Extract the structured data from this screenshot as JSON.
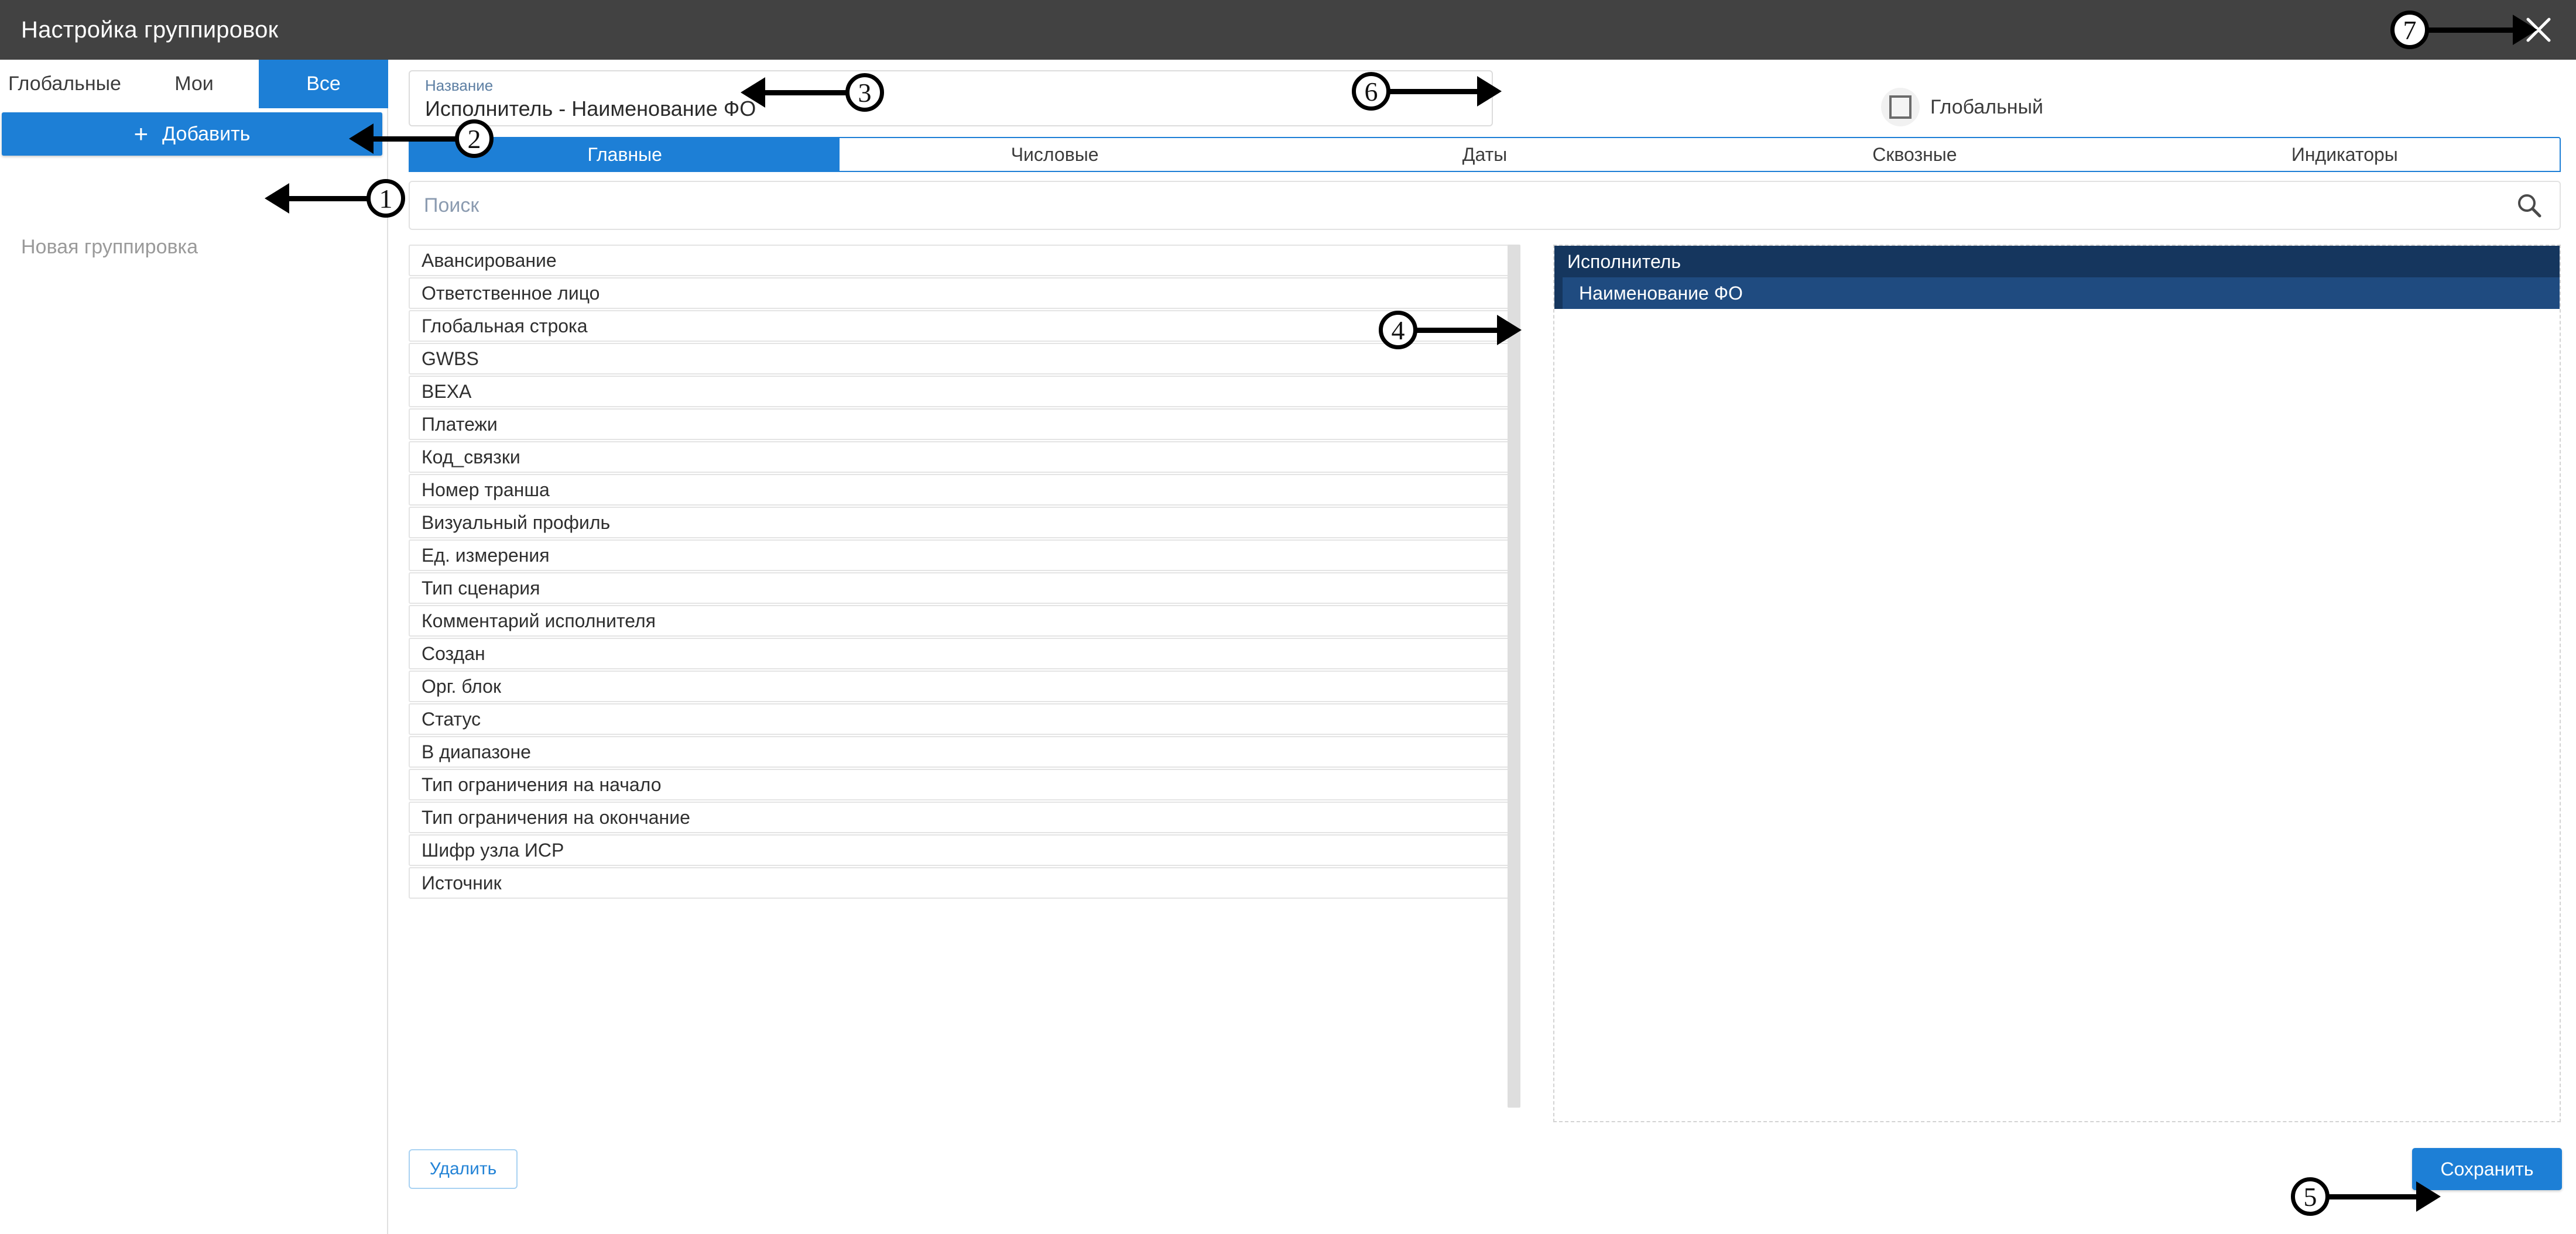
{
  "window": {
    "title": "Настройка группировок",
    "close_icon": "close-icon"
  },
  "sidebar": {
    "segments": [
      {
        "label": "Глобальные",
        "active": false
      },
      {
        "label": "Мои",
        "active": false
      },
      {
        "label": "Все",
        "active": true
      }
    ],
    "add_button": {
      "label": "Добавить",
      "icon": "plus-icon"
    },
    "groups": [
      {
        "label": "Новая группировка"
      }
    ]
  },
  "name_field": {
    "label": "Название",
    "value": "Исполнитель - Наименование ФО"
  },
  "global_checkbox": {
    "label": "Глобальный",
    "checked": false
  },
  "tabs": [
    {
      "label": "Главные",
      "active": true
    },
    {
      "label": "Числовые",
      "active": false
    },
    {
      "label": "Даты",
      "active": false
    },
    {
      "label": "Сквозные",
      "active": false
    },
    {
      "label": "Индикаторы",
      "active": false
    }
  ],
  "search": {
    "placeholder": "Поиск",
    "value": "",
    "icon": "search-icon"
  },
  "available_fields": [
    "Авансирование",
    "Ответственное лицо",
    "Глобальная строка",
    "GWBS",
    "ВЕХА",
    "Платежи",
    "Код_связки",
    "Номер транша",
    "Визуальный профиль",
    "Ед. измерения",
    "Тип сценария",
    "Комментарий исполнителя",
    "Создан",
    "Орг. блок",
    "Статус",
    "В диапазоне",
    "Тип ограничения на начало",
    "Тип ограничения на окончание",
    "Шифр узла ИСР",
    "Источник"
  ],
  "selected_fields": [
    {
      "label": "Исполнитель",
      "level": 0
    },
    {
      "label": "Наименование ФО",
      "level": 1
    }
  ],
  "footer": {
    "delete_label": "Удалить",
    "save_label": "Сохранить"
  },
  "annotations": [
    {
      "number": "1"
    },
    {
      "number": "2"
    },
    {
      "number": "3"
    },
    {
      "number": "4"
    },
    {
      "number": "5"
    },
    {
      "number": "6"
    },
    {
      "number": "7"
    }
  ],
  "colors": {
    "accent": "#1d7fd6",
    "titlebar": "#424242",
    "selected_dark": "#15365e",
    "selected_light": "#1f4b80"
  }
}
